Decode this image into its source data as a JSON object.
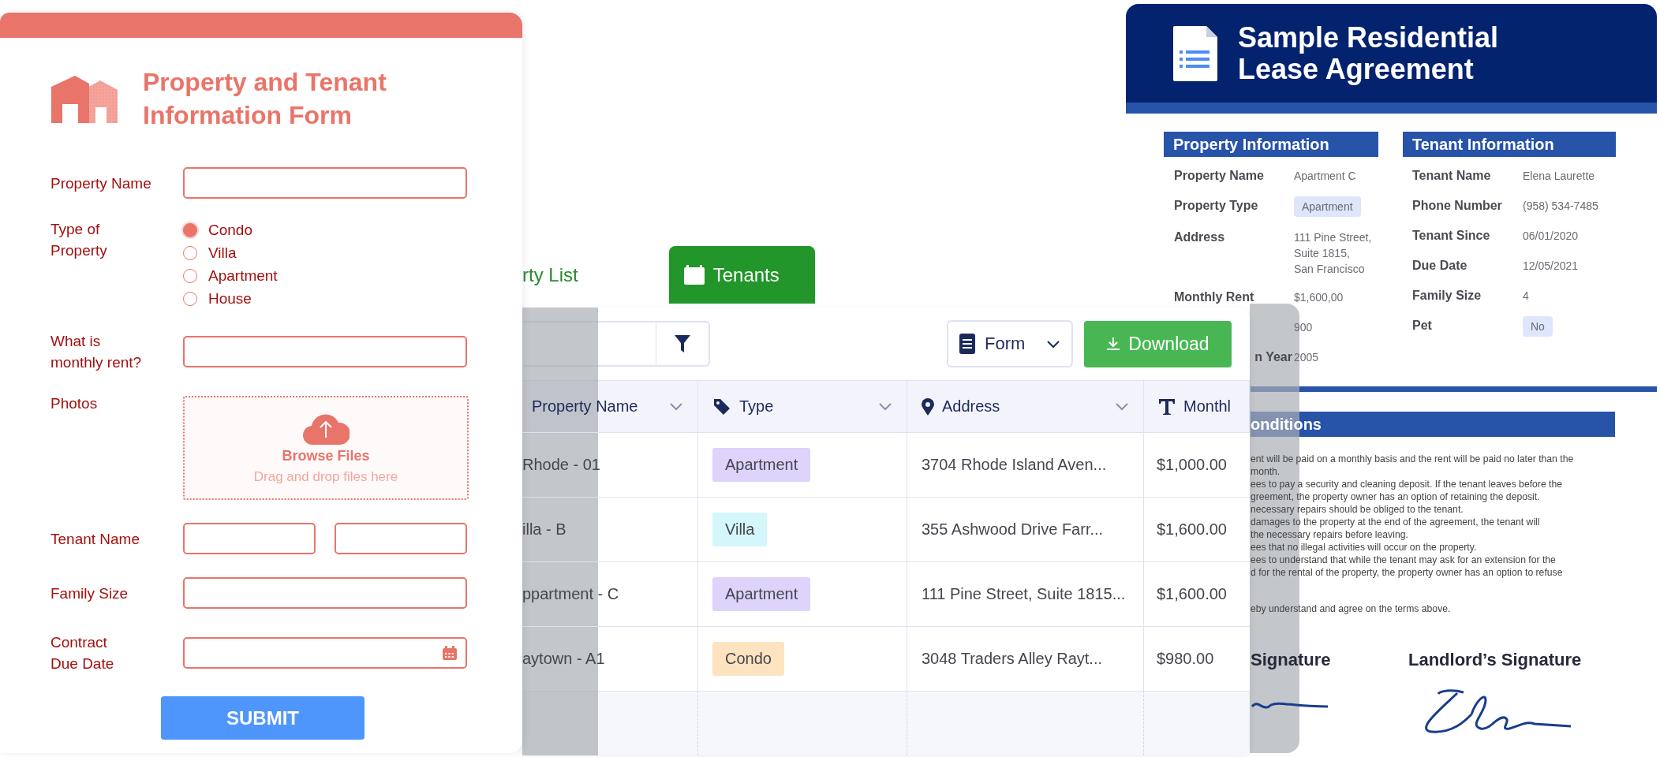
{
  "form": {
    "title": "Property and Tenant\nInformation Form",
    "fields": [
      {
        "kind": "text",
        "label": "Property Name"
      },
      {
        "kind": "radio",
        "label": "Type of\nProperty",
        "options": [
          {
            "label": "Condo",
            "selected": true
          },
          {
            "label": "Villa",
            "selected": false
          },
          {
            "label": "Apartment",
            "selected": false
          },
          {
            "label": "House",
            "selected": false
          }
        ]
      },
      {
        "kind": "text",
        "label": "What is\nmonthly rent?"
      },
      {
        "kind": "upload",
        "label": "Photos",
        "action": "Browse Files",
        "hint": "Drag and drop files here"
      },
      {
        "kind": "name",
        "label": "Tenant Name"
      },
      {
        "kind": "text",
        "label": "Family Size"
      },
      {
        "kind": "date",
        "label": "Contract\nDue Date"
      }
    ],
    "submit": "SUBMIT"
  },
  "table_app": {
    "tabs": [
      {
        "label": "rty List",
        "selected": false,
        "kind": "plain"
      },
      {
        "label": "Tenants",
        "selected": true,
        "kind": "calendar"
      }
    ],
    "view_select": "Form",
    "download": "Download",
    "columns": [
      {
        "label": "Property Name",
        "kind": "plain",
        "sortable": true
      },
      {
        "label": "Type",
        "kind": "tag",
        "sortable": true
      },
      {
        "label": "Address",
        "kind": "location",
        "sortable": true
      },
      {
        "label": "Monthl",
        "kind": "text",
        "sortable": false
      }
    ],
    "rows": [
      {
        "name": "Rhode - 01",
        "type": {
          "label": "Apartment",
          "color": "#ddd3fb"
        },
        "address": "3704 Rhode Island Aven...",
        "rent": "$1,000.00"
      },
      {
        "name": "illa - B",
        "type": {
          "label": "Villa",
          "color": "#d3f7fb"
        },
        "address": "355 Ashwood Drive Farr...",
        "rent": "$1,600.00"
      },
      {
        "name": "ppartment - C",
        "type": {
          "label": "Apartment",
          "color": "#ddd3fb"
        },
        "address": "111 Pine Street, Suite 1815...",
        "rent": "$1,600.00"
      },
      {
        "name": "aytown - A1",
        "type": {
          "label": "Condo",
          "color": "#fde3bf"
        },
        "address": "3048 Traders Alley Rayt...",
        "rent": "$980.00"
      }
    ]
  },
  "lease_document": {
    "title": "Sample Residential\nLease Agreement",
    "property_info": {
      "heading": "Property Information",
      "rows": [
        {
          "label": "Property Name",
          "value": "Apartment C",
          "kind": "plain"
        },
        {
          "label": "Property Type",
          "value": "Apartment",
          "kind": "chip"
        },
        {
          "label": "Address",
          "value": "111 Pine Street,\nSuite 1815,\nSan Francisco",
          "kind": "plain"
        },
        {
          "label": "Monthly Rent",
          "value": "$1,600,00",
          "kind": "plain"
        },
        {
          "value": "900",
          "kind": "plain"
        },
        {
          "label": "n Year",
          "value": "2005",
          "kind": "cut"
        }
      ]
    },
    "tenant_info": {
      "heading": "Tenant Information",
      "rows": [
        {
          "label": "Tenant Name",
          "value": "Elena Laurette",
          "kind": "plain"
        },
        {
          "label": "Phone Number",
          "value": "(958) 534-7485",
          "kind": "plain"
        },
        {
          "label": "Tenant Since",
          "value": "06/01/2020",
          "kind": "plain"
        },
        {
          "label": "Due Date",
          "value": "12/05/2021",
          "kind": "plain"
        },
        {
          "label": "Family Size",
          "value": "4",
          "kind": "plain"
        },
        {
          "label": "Pet",
          "value": "No",
          "kind": "chip"
        }
      ]
    },
    "conditions": {
      "heading": "onditions",
      "lines": [
        "ent will be paid on a monthly basis and the rent will be paid no later than the",
        "month.",
        "ees to pay a security and cleaning deposit. If the tenant leaves before the",
        "greement, the property owner has an option of retaining the deposit.",
        "necessary repairs should be obliged to the tenant.",
        "damages to the property at the end of the agreement, the tenant will",
        "the necessary repairs before leaving.",
        "ees that no illegal activities will occur on the property.",
        "ees to understand that while the tenant may ask for an extension for the",
        "d for the rental of the property, the property owner has an option to refuse"
      ],
      "closing": "eby understand and agree on the terms above."
    },
    "signatures": [
      {
        "label": "Signature"
      },
      {
        "label": "Landlord’s Signature"
      }
    ]
  }
}
